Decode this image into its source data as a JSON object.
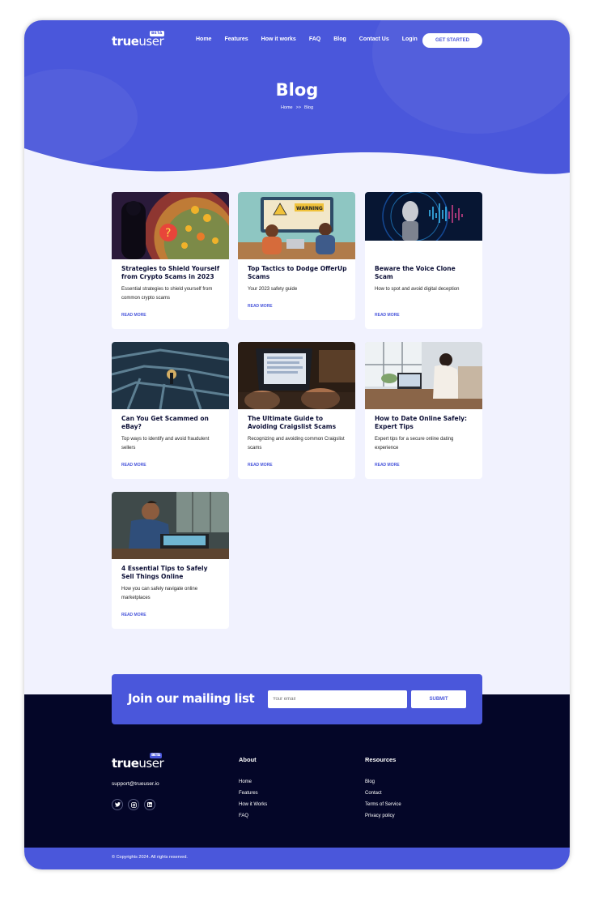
{
  "brand": {
    "logo_true": "true",
    "logo_user": "user",
    "badge": "BETA",
    "primary": "#4a57db",
    "dark": "#040628",
    "bg": "#f1f2fe"
  },
  "nav": {
    "links": [
      "Home",
      "Features",
      "How it works",
      "FAQ",
      "Blog",
      "Contact Us",
      "Login"
    ],
    "cta": "GET STARTED"
  },
  "hero": {
    "title": "Blog",
    "breadcrumb": [
      "Home",
      ">>",
      "Blog"
    ]
  },
  "posts": [
    {
      "title": "Strategies to Shield Yourself from Crypto Scams in 2023",
      "desc": "Essential strategies to shield yourself from common crypto scams",
      "more": "READ MORE",
      "image": "crypto-scam-image"
    },
    {
      "title": "Top Tactics to Dodge OfferUp Scams",
      "desc": "Your 2023 safety guide",
      "more": "READ MORE",
      "image": "offerup-warning-image"
    },
    {
      "title": "Beware the Voice Clone Scam",
      "desc": "How to spot and avoid digital deception",
      "more": "READ MORE",
      "image": "voice-clone-robot-image"
    },
    {
      "title": "Can You Get Scammed on eBay?",
      "desc": "Top ways to identify and avoid fraudulent sellers",
      "more": "READ MORE",
      "image": "maze-image"
    },
    {
      "title": "The Ultimate Guide to Avoiding Craigslist Scams",
      "desc": "Recognizing and avoiding common Craigslist scams",
      "more": "READ MORE",
      "image": "laptop-hands-image"
    },
    {
      "title": "How to Date Online Safely: Expert Tips",
      "desc": "Expert tips for a secure online dating experience",
      "more": "READ MORE",
      "image": "woman-desk-image"
    },
    {
      "title": "4 Essential Tips to Safely Sell Things Online",
      "desc": "How you can safely navigate online marketplaces",
      "more": "READ MORE",
      "image": "man-laptop-image"
    }
  ],
  "mailing": {
    "heading": "Join our mailing list",
    "placeholder": "Your email",
    "button": "SUBMIT"
  },
  "footer": {
    "email": "support@trueuser.io",
    "social": [
      "twitter-icon",
      "instagram-icon",
      "linkedin-icon"
    ],
    "about": {
      "heading": "About",
      "links": [
        "Home",
        "Features",
        "How it Works",
        "FAQ"
      ]
    },
    "resources": {
      "heading": "Resources",
      "links": [
        "Blog",
        "Contact",
        "Terms of Service",
        "Privacy policy"
      ]
    },
    "copyright": "© Copyrights 2024. All rights reserved."
  }
}
